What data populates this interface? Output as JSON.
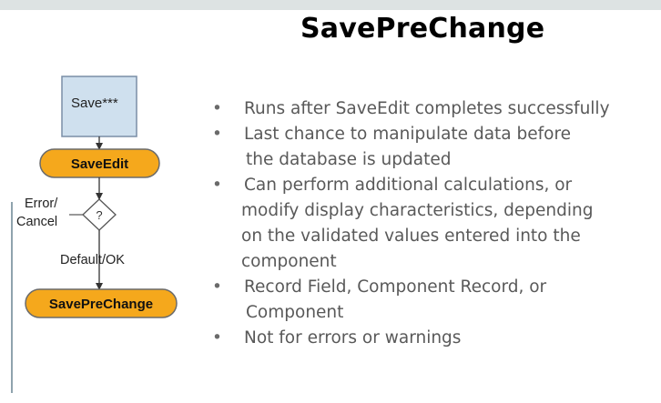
{
  "title": "SavePreChange",
  "flow": {
    "start_label": "Save***",
    "step1_label": "SaveEdit",
    "decision_symbol": "?",
    "error_label_line1": "Error/",
    "error_label_line2": "Cancel",
    "default_label": "Default/OK",
    "step2_label": "SavePreChange"
  },
  "bullets": [
    {
      "lines": [
        "Runs after SaveEdit completes successfully"
      ]
    },
    {
      "lines": [
        "Last chance to manipulate data before",
        "the database is updated"
      ]
    },
    {
      "lines": [
        "Can perform additional calculations, or",
        "modify display characteristics, depending",
        "on the validated values entered into the",
        "component"
      ]
    },
    {
      "lines": [
        "Record Field, Component Record, or",
        "Component"
      ]
    },
    {
      "lines": [
        "Not for errors or warnings"
      ]
    }
  ],
  "colors": {
    "start_box_fill": "#cfe0ee",
    "start_box_stroke": "#7a8ea6",
    "pill_fill": "#f5a81c",
    "pill_stroke": "#6b6b6b",
    "bullet_text": "#595959"
  }
}
